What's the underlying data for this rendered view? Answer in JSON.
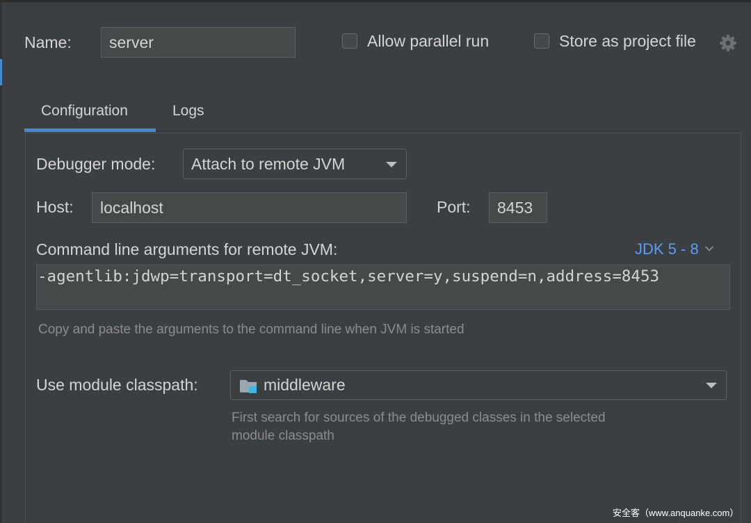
{
  "header": {
    "name_label": "Name:",
    "name_value": "server",
    "allow_parallel_label": "Allow parallel run",
    "store_project_label": "Store as project file"
  },
  "tabs": [
    {
      "label": "Configuration",
      "active": true
    },
    {
      "label": "Logs",
      "active": false
    }
  ],
  "config": {
    "debugger_mode_label": "Debugger mode:",
    "debugger_mode_value": "Attach to remote JVM",
    "host_label": "Host:",
    "host_value": "localhost",
    "port_label": "Port:",
    "port_value": "8453",
    "cmd_label": "Command line arguments for remote JVM:",
    "jdk_link": "JDK 5 - 8",
    "cmd_value": "-agentlib:jdwp=transport=dt_socket,server=y,suspend=n,address=8453",
    "cmd_hint": "Copy and paste the arguments to the command line when JVM is started",
    "classpath_label": "Use module classpath:",
    "classpath_value": "middleware",
    "classpath_hint_line1": "First search for sources of the debugged classes in the selected",
    "classpath_hint_line2": "module classpath"
  },
  "watermark": "安全客（www.anquanke.com）",
  "colors": {
    "background": "#3c3f41",
    "accent": "#4a88c7",
    "link": "#589df6"
  }
}
